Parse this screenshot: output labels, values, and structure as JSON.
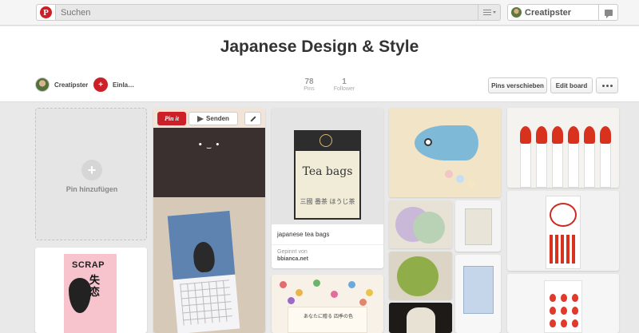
{
  "header": {
    "logo": "P",
    "search_placeholder": "Suchen",
    "username": "Creatipster"
  },
  "board": {
    "title": "Japanese Design & Style",
    "owner": "Creatipster",
    "invite_label": "Einla…",
    "pins_count": "78",
    "pins_label": "Pins",
    "followers_count": "1",
    "followers_label": "Follower",
    "move_pins_label": "Pins verschieben",
    "edit_board_label": "Edit board"
  },
  "add_pin": {
    "icon": "+",
    "label": "Pin hinzufügen"
  },
  "pins": {
    "calendar": {
      "pin_it": "Pin it",
      "send": "Senden",
      "face": "• ‿ •"
    },
    "scrap": {
      "title": "SCRAP",
      "kanji": "失恋"
    },
    "tea": {
      "box_text": "Tea bags",
      "box_sub": "三國 番茶 ほうじ茶",
      "description": "japanese tea bags",
      "pinned_from_label": "Gepinnt von",
      "source": "bbianca.net"
    },
    "dots": {
      "text": "あなたに贈る 四季の色"
    }
  },
  "colors": {
    "pinterest_red": "#cb2027",
    "page_bg": "#e9e9e9"
  }
}
